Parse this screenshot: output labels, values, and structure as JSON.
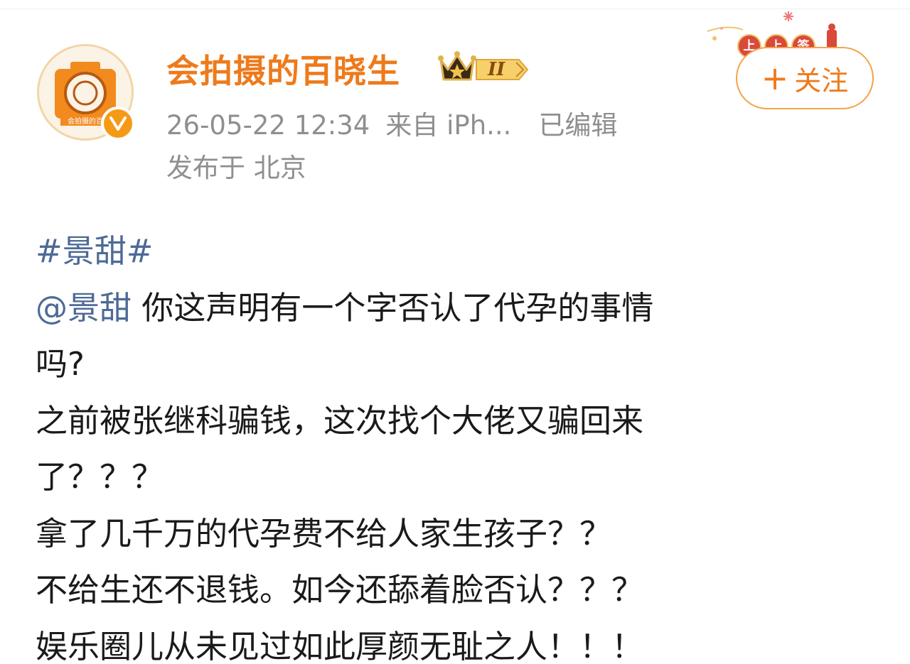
{
  "user": {
    "name": "会拍摄的百晓生",
    "level": "II",
    "avatar_text": "会拍摄的百"
  },
  "meta": {
    "time": "26-05-22 12:34",
    "source": "来自 iPh...",
    "edited": "已编辑",
    "location": "发布于 北京"
  },
  "lottery": {
    "chars": [
      "上",
      "上",
      "签"
    ]
  },
  "follow": {
    "plus": "+",
    "label": "关注"
  },
  "post": {
    "hashtag": "#景甜#",
    "mention": "@景甜",
    "line1_rest": " 你这声明有一个字否认了代孕的事情",
    "line2": "吗?",
    "line3": "之前被张继科骗钱，这次找个大佬又骗回来",
    "line4": "了？？？",
    "line5": "拿了几千万的代孕费不给人家生孩子？？",
    "line6": "不给生还不退钱。如今还舔着脸否认？？？",
    "line7": "娱乐圈儿从未见过如此厚颜无耻之人！！！"
  },
  "colors": {
    "username": "#ee7a1b",
    "link": "#4d6a97",
    "meta": "#8f8f8f",
    "text": "#1a1a1a",
    "verified": "#f59a16"
  },
  "icons": {
    "verified": "verified-v-icon",
    "crown": "crown-icon",
    "plus": "plus-icon"
  }
}
